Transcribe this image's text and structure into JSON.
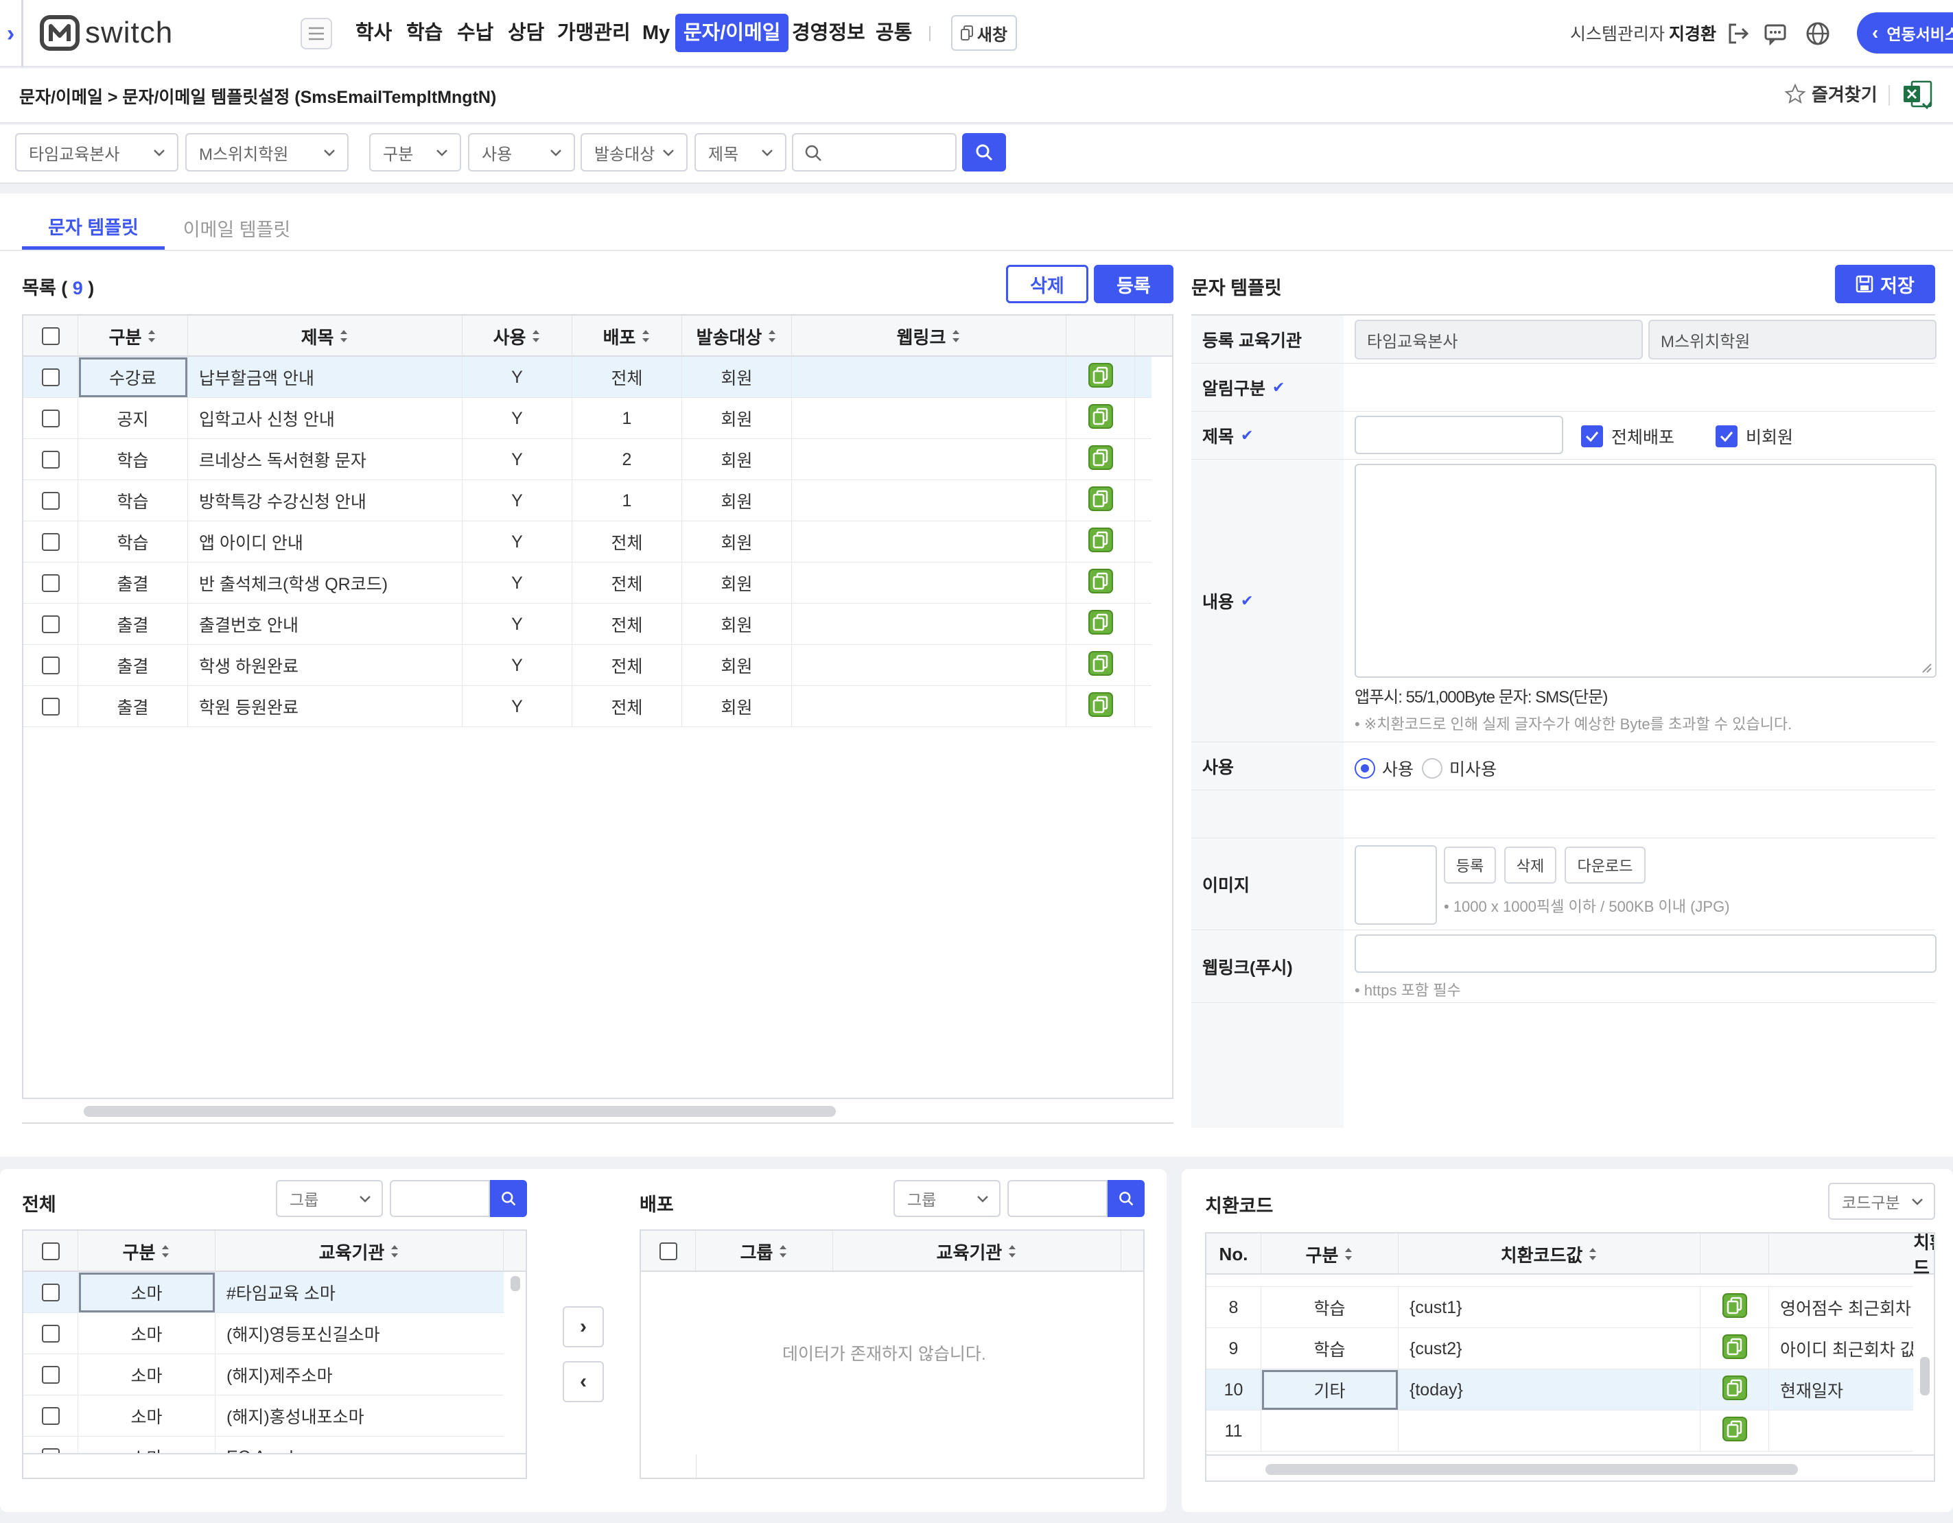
{
  "header": {
    "logo_text": "switch",
    "menus": [
      "학사",
      "학습",
      "수납",
      "상담",
      "가맹관리",
      "My",
      "문자/이메일",
      "경영정보",
      "공통"
    ],
    "active_menu": "문자/이메일",
    "new_window": "새창",
    "admin_label": "시스템관리자",
    "admin_name": "지경환",
    "service_button": "연동서비스"
  },
  "breadcrumb": "문자/이메일 > 문자/이메일 템플릿설정 (SmsEmailTempltMngtN)",
  "favorites": "즐겨찾기",
  "filters": {
    "org": "타임교육본사",
    "academy": "M스위치학원",
    "category": "구분",
    "use": "사용",
    "target": "발송대상",
    "title": "제목",
    "search_placeholder": ""
  },
  "tabs": [
    "문자 템플릿",
    "이메일 템플릿"
  ],
  "list": {
    "title": "목록",
    "count": "9",
    "delete_label": "삭제",
    "register_label": "등록",
    "columns": [
      "구분",
      "제목",
      "사용",
      "배포",
      "발송대상",
      "웹링크"
    ],
    "rows": [
      {
        "category": "수강료",
        "title": "납부할금액 안내",
        "use": "Y",
        "deploy": "전체",
        "target": "회원",
        "weblink": ""
      },
      {
        "category": "공지",
        "title": "입학고사 신청 안내",
        "use": "Y",
        "deploy": "1",
        "target": "회원",
        "weblink": ""
      },
      {
        "category": "학습",
        "title": "르네상스 독서현황 문자",
        "use": "Y",
        "deploy": "2",
        "target": "회원",
        "weblink": ""
      },
      {
        "category": "학습",
        "title": "방학특강 수강신청 안내",
        "use": "Y",
        "deploy": "1",
        "target": "회원",
        "weblink": ""
      },
      {
        "category": "학습",
        "title": "앱 아이디 안내",
        "use": "Y",
        "deploy": "전체",
        "target": "회원",
        "weblink": ""
      },
      {
        "category": "출결",
        "title": "반 출석체크(학생 QR코드)",
        "use": "Y",
        "deploy": "전체",
        "target": "회원",
        "weblink": ""
      },
      {
        "category": "출결",
        "title": "출결번호 안내",
        "use": "Y",
        "deploy": "전체",
        "target": "회원",
        "weblink": ""
      },
      {
        "category": "출결",
        "title": "학생 하원완료",
        "use": "Y",
        "deploy": "전체",
        "target": "회원",
        "weblink": ""
      },
      {
        "category": "출결",
        "title": "학원 등원완료",
        "use": "Y",
        "deploy": "전체",
        "target": "회원",
        "weblink": ""
      }
    ]
  },
  "form": {
    "title": "문자 템플릿",
    "save_label": "저장",
    "labels": {
      "org": "등록 교육기관",
      "notify": "알림구분",
      "subject": "제목",
      "content": "내용",
      "use": "사용",
      "image": "이미지",
      "weblink": "웹링크(푸시)"
    },
    "org_value": "타임교육본사",
    "academy_value": "M스위치학원",
    "all_deploy": "전체배포",
    "non_member": "비회원",
    "byte_info": "앱푸시: 55/1,000Byte  문자: SMS(단문)",
    "byte_note": "• ※치환코드로 인해 실제 글자수가 예상한 Byte를 초과할 수 있습니다.",
    "use_on": "사용",
    "use_off": "미사용",
    "img_register": "등록",
    "img_delete": "삭제",
    "img_download": "다운로드",
    "img_note": "• 1000 x 1000픽셀 이하 / 500KB 이내 (JPG)",
    "weblink_note": "• https 포함 필수"
  },
  "all_panel": {
    "title": "전체",
    "group_placeholder": "그룹",
    "columns": [
      "구분",
      "교육기관"
    ],
    "rows": [
      {
        "category": "소마",
        "org": "#타임교육 소마"
      },
      {
        "category": "소마",
        "org": "(해지)영등포신길소마"
      },
      {
        "category": "소마",
        "org": "(해지)제주소마"
      },
      {
        "category": "소마",
        "org": "(해지)홍성내포소마"
      },
      {
        "category": "소마",
        "org": "EC Academy"
      }
    ]
  },
  "deploy_panel": {
    "title": "배포",
    "group_placeholder": "그룹",
    "columns": [
      "그룹",
      "교육기관"
    ],
    "empty_text": "데이터가 존재하지 않습니다."
  },
  "code_panel": {
    "title": "치환코드",
    "code_select": "코드구분",
    "columns": [
      "No.",
      "구분",
      "치환코드값",
      "",
      "치환코드"
    ],
    "rows": [
      {
        "no": "8",
        "category": "학습",
        "code": "{cust1}",
        "desc": "영어점수 최근회차"
      },
      {
        "no": "9",
        "category": "학습",
        "code": "{cust2}",
        "desc": "아이디 최근회차 값"
      },
      {
        "no": "10",
        "category": "기타",
        "code": "{today}",
        "desc": "현재일자"
      },
      {
        "no": "11",
        "category": "",
        "code": "",
        "desc": ""
      }
    ]
  }
}
